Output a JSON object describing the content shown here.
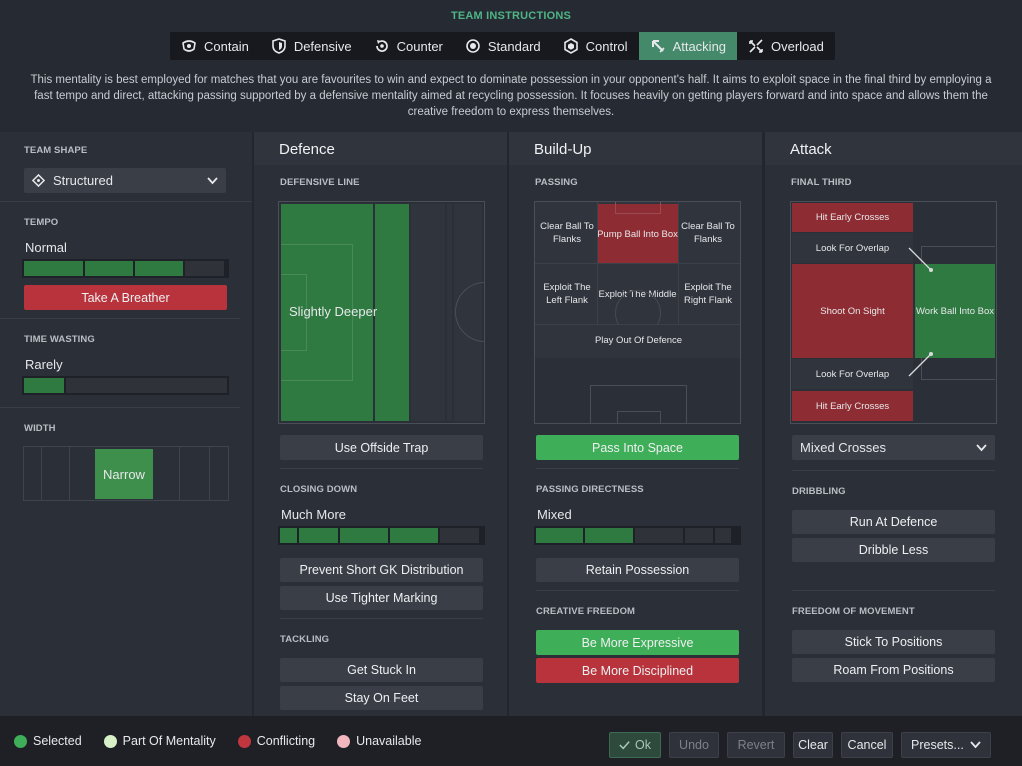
{
  "title": "TEAM INSTRUCTIONS",
  "tabs": [
    {
      "label": "Contain",
      "icon": "contain-icon"
    },
    {
      "label": "Defensive",
      "icon": "shield-icon"
    },
    {
      "label": "Counter",
      "icon": "counter-icon"
    },
    {
      "label": "Standard",
      "icon": "standard-icon"
    },
    {
      "label": "Control",
      "icon": "control-icon"
    },
    {
      "label": "Attacking",
      "icon": "attacking-icon",
      "active": true
    },
    {
      "label": "Overload",
      "icon": "overload-icon"
    }
  ],
  "description": "This mentality is best employed for matches that you are favourites to win and expect to dominate possession in your opponent's half. It aims to exploit space in the final third by employing a fast tempo and direct, attacking passing supported by a defensive mentality aimed at recycling possession. It focuses heavily on getting players forward and into space and allows them the creative freedom to express themselves.",
  "left": {
    "team_shape_label": "TEAM SHAPE",
    "team_shape_value": "Structured",
    "tempo_label": "TEMPO",
    "tempo_value": "Normal",
    "tempo_level": 3,
    "take_breather": "Take A Breather",
    "time_wasting_label": "TIME WASTING",
    "time_wasting_value": "Rarely",
    "time_wasting_level": 1,
    "width_label": "WIDTH",
    "width_value": "Narrow"
  },
  "defence": {
    "header": "Defence",
    "defensive_line_label": "DEFENSIVE LINE",
    "defensive_line_value": "Slightly Deeper",
    "offside_trap": "Use Offside Trap",
    "closing_down_label": "CLOSING DOWN",
    "closing_down_value": "Much More",
    "closing_down_level": 4,
    "prevent_short_gk": "Prevent Short GK Distribution",
    "tighter_marking": "Use Tighter Marking",
    "tackling_label": "TACKLING",
    "get_stuck_in": "Get Stuck In",
    "stay_on_feet": "Stay On Feet"
  },
  "buildup": {
    "header": "Build-Up",
    "passing_label": "PASSING",
    "passing_cells": {
      "clear_left": "Clear Ball To Flanks",
      "pump_ball": "Pump Ball Into Box",
      "clear_right": "Clear Ball To Flanks",
      "exploit_left": "Exploit The Left Flank",
      "exploit_middle": "Exploit The Middle",
      "exploit_right": "Exploit The Right Flank",
      "play_out": "Play Out Of Defence"
    },
    "pass_into_space": "Pass Into Space",
    "passing_directness_label": "PASSING DIRECTNESS",
    "passing_directness_value": "Mixed",
    "passing_directness_level": 2,
    "retain_possession": "Retain Possession",
    "creative_freedom_label": "CREATIVE FREEDOM",
    "be_more_expressive": "Be More Expressive",
    "be_more_disciplined": "Be More Disciplined"
  },
  "attack": {
    "header": "Attack",
    "final_third_label": "FINAL THIRD",
    "final_cells": {
      "hit_early_top": "Hit Early Crosses",
      "overlap_top": "Look For Overlap",
      "shoot_on_sight": "Shoot On Sight",
      "work_ball": "Work Ball Into Box",
      "overlap_bottom": "Look For Overlap",
      "hit_early_bottom": "Hit Early Crosses"
    },
    "crosses_value": "Mixed Crosses",
    "dribbling_label": "DRIBBLING",
    "run_at_defence": "Run At Defence",
    "dribble_less": "Dribble Less",
    "freedom_label": "FREEDOM OF MOVEMENT",
    "stick_to_positions": "Stick To Positions",
    "roam_from_positions": "Roam From Positions"
  },
  "legend": {
    "selected": "Selected",
    "part_of_mentality": "Part Of Mentality",
    "conflicting": "Conflicting",
    "unavailable": "Unavailable",
    "colors": {
      "selected": "#3fae58",
      "part": "#d8f0c8",
      "conflicting": "#c0363e",
      "unavailable": "#f2b6be"
    }
  },
  "footer_buttons": {
    "ok": "Ok",
    "undo": "Undo",
    "revert": "Revert",
    "clear": "Clear",
    "cancel": "Cancel",
    "presets": "Presets..."
  }
}
